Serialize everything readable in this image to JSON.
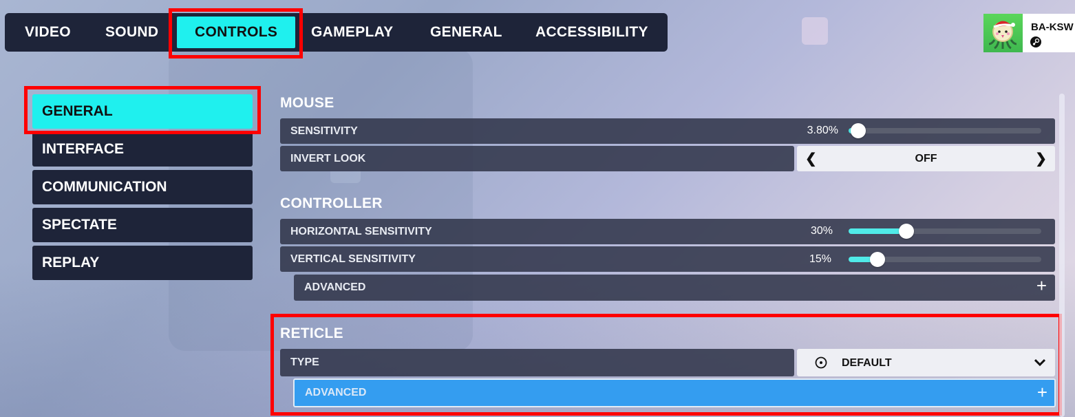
{
  "top_tabs": [
    {
      "label": "VIDEO",
      "active": false
    },
    {
      "label": "SOUND",
      "active": false
    },
    {
      "label": "CONTROLS",
      "active": true
    },
    {
      "label": "GAMEPLAY",
      "active": false
    },
    {
      "label": "GENERAL",
      "active": false
    },
    {
      "label": "ACCESSIBILITY",
      "active": false
    }
  ],
  "profile": {
    "name": "BA-KSW",
    "platform_icon": "steam-icon",
    "avatar": "pachimari-santa-hat"
  },
  "sidebar": {
    "items": [
      {
        "label": "GENERAL",
        "active": true
      },
      {
        "label": "INTERFACE",
        "active": false
      },
      {
        "label": "COMMUNICATION",
        "active": false
      },
      {
        "label": "SPECTATE",
        "active": false
      },
      {
        "label": "REPLAY",
        "active": false
      }
    ]
  },
  "sections": {
    "mouse": {
      "title": "MOUSE",
      "sensitivity": {
        "label": "SENSITIVITY",
        "value_text": "3.80%",
        "fraction": 0.038
      },
      "invert_look": {
        "label": "INVERT LOOK",
        "value": "OFF",
        "prev_icon": "chevron-left-icon",
        "next_icon": "chevron-right-icon"
      }
    },
    "controller": {
      "title": "CONTROLLER",
      "horizontal": {
        "label": "HORIZONTAL SENSITIVITY",
        "value_text": "30%",
        "fraction": 0.3
      },
      "vertical": {
        "label": "VERTICAL SENSITIVITY",
        "value_text": "15%",
        "fraction": 0.15
      },
      "advanced": {
        "label": "ADVANCED",
        "icon": "plus-icon"
      }
    },
    "reticle": {
      "title": "RETICLE",
      "type": {
        "label": "TYPE",
        "value": "DEFAULT",
        "value_icon": "reticle-dot-icon",
        "dropdown_icon": "chevron-down-icon"
      },
      "advanced": {
        "label": "ADVANCED",
        "icon": "plus-icon",
        "highlighted": true
      }
    }
  },
  "colors": {
    "accent_cyan": "#1ff0ee",
    "slider_fill": "#50eae8",
    "highlight_blue": "#349df0",
    "annotation_red": "#ff0000",
    "nav_bg": "#1e2439"
  }
}
